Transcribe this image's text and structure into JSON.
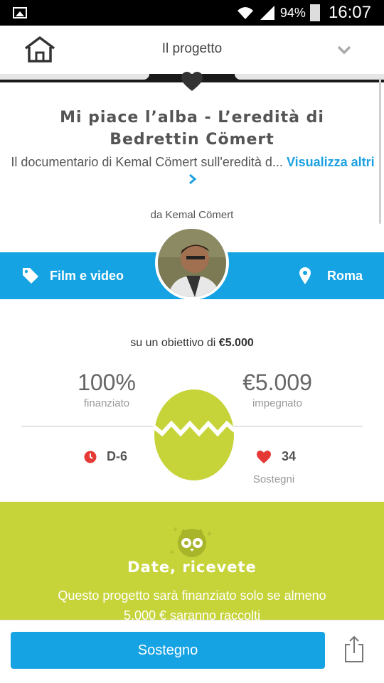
{
  "status": {
    "battery": "94%",
    "time": "16:07"
  },
  "header": {
    "title": "Il progetto"
  },
  "project": {
    "title": "Mi piace l’alba - L’eredità di Bedrettin Cömert",
    "description": "Il documentario di Kemal Cömert sull'eredità d...",
    "more_label": "Visualizza altri",
    "author": "da Kemal Cömert"
  },
  "category": {
    "label": "Film e video",
    "location": "Roma"
  },
  "funding": {
    "goal_prefix": "su un obiettivo di",
    "goal_amount": "€5.000",
    "percent": "100%",
    "percent_label": "finanziato",
    "pledged": "€5.009",
    "pledged_label": "impegnato",
    "days_left": "D-6",
    "backers": "34",
    "backers_label": "Sostegni"
  },
  "info": {
    "title": "Date, ricevete",
    "text": "Questo progetto sarà finanziato solo se almeno 5.000 € saranno raccolti"
  },
  "footer": {
    "support_label": "Sostegno"
  },
  "colors": {
    "brand_blue": "#16a3e3",
    "accent_green": "#c6d43a",
    "alert_red": "#e53935"
  }
}
